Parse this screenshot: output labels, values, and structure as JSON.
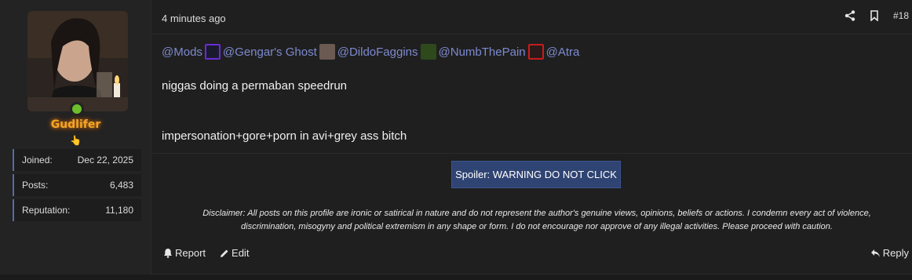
{
  "post": {
    "timestamp": "4 minutes ago",
    "number": "#18",
    "mentions": [
      {
        "text": "@Mods",
        "avatar_color": "#1a1a2e",
        "avatar_border": "#6a2bd6"
      },
      {
        "text": "@Gengar's Ghost",
        "avatar_color": "#6b5a52",
        "avatar_border": "#444444"
      },
      {
        "text": "@DildoFaggins",
        "avatar_color": "#2e4a1c",
        "avatar_border": "#3a5a22"
      },
      {
        "text": "@NumbThePain",
        "avatar_color": "#2a1a1a",
        "avatar_border": "#c81c1c"
      },
      {
        "text": "@Atra",
        "avatar_color": "",
        "avatar_border": ""
      }
    ],
    "body_lines": [
      "niggas doing a permaban speedrun",
      "impersonation+gore+porn in avi+grey ass bitch"
    ],
    "spoiler_label": "Spoiler: WARNING DO NOT CLICK",
    "disclaimer_lines": [
      "Disclaimer: All posts on this profile are ironic or satirical in nature and do not represent the author's genuine views, opinions, beliefs or actions. I condemn every act of violence,",
      "discrimination, misogyny and political extremism in any shape or form. I do not encourage nor approve of any illegal activities. Please proceed with caution."
    ],
    "actions": {
      "report": "Report",
      "edit": "Edit",
      "reply": "Reply"
    }
  },
  "user": {
    "username": "Gudlifer",
    "badge_icon": "pointing-hand-emoji",
    "online_status": "online",
    "stats": [
      {
        "label": "Joined:",
        "value": "Dec 22, 2025"
      },
      {
        "label": "Posts:",
        "value": "6,483"
      },
      {
        "label": "Reputation:",
        "value": "11,180"
      }
    ]
  },
  "colors": {
    "mention": "#7d8ad0",
    "username": "#f5a623",
    "spoiler_bg": "#2f4473",
    "online": "#6cbf2a",
    "stat_accent": "#5a6aa8"
  },
  "icons": {
    "share": "share-icon",
    "bookmark": "bookmark-icon",
    "report": "bell-icon",
    "edit": "pencil-icon",
    "reply": "reply-arrow-icon"
  }
}
